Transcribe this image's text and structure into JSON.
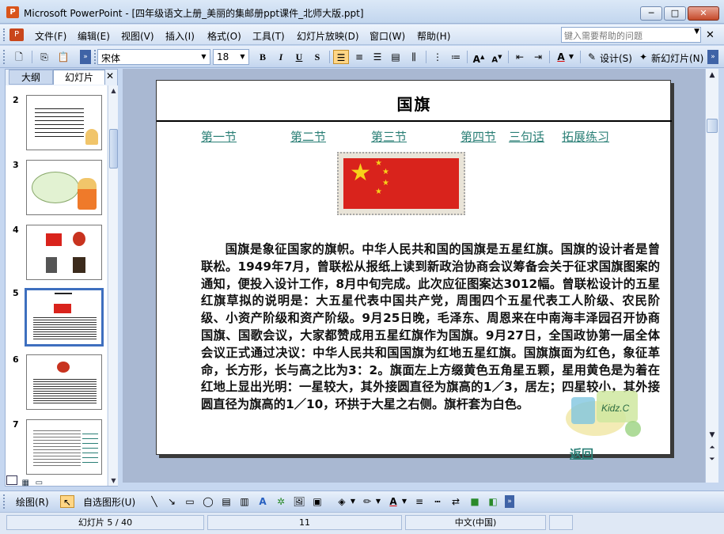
{
  "window": {
    "title": "Microsoft PowerPoint - [四年级语文上册_美丽的集邮册ppt课件_北师大版.ppt]",
    "minimize": "─",
    "maximize": "□",
    "close": "✕"
  },
  "menu": {
    "items": [
      "文件(F)",
      "编辑(E)",
      "视图(V)",
      "插入(I)",
      "格式(O)",
      "工具(T)",
      "幻灯片放映(D)",
      "窗口(W)",
      "帮助(H)"
    ],
    "help_placeholder": "键入需要帮助的问题",
    "mdi_close": "✕"
  },
  "toolbar": {
    "font_name": "宋体",
    "font_size": "18",
    "bold": "B",
    "italic": "I",
    "underline": "U",
    "shadow": "S",
    "design_label": "设计(S)",
    "new_slide_label": "新幻灯片(N)"
  },
  "left_pane": {
    "tab_outline": "大纲",
    "tab_slides": "幻灯片",
    "close": "✕",
    "slide_numbers": [
      "2",
      "3",
      "4",
      "5",
      "6",
      "7"
    ],
    "selected_slide": "5"
  },
  "slide": {
    "title": "国旗",
    "nav_links": [
      "第一节",
      "第二节",
      "第三节",
      "第四节",
      "三句话",
      "拓展练习"
    ],
    "body": "国旗是象征国家的旗帜。中华人民共和国的国旗是五星红旗。国旗的设计者是曾联松。1949年7月，曾联松从报纸上读到新政治协商会议筹备会关于征求国旗图案的通知，便投入设计工作，8月中旬完成。此次应征图案达3012幅。曾联松设计的五星红旗草拟的说明是：大五星代表中国共产党，周围四个五星代表工人阶级、农民阶级、小资产阶级和资产阶级。9月25日晚，毛泽东、周恩来在中南海丰泽园召开协商国旗、国歌会议，大家都赞成用五星红旗作为国旗。9月27日，全国政协第一届全体会议正式通过决议：中华人民共和国国旗为红地五星红旗。国旗旗面为红色，象征革命，长方形，长与高之比为3：2。旗面左上方缀黄色五角星五颗，星用黄色是为着在红地上显出光明：一星较大，其外接圆直径为旗高的1／3，居左；四星较小，其外接圆直径为旗高的1／10，环拱于大星之右侧。旗杆套为白色。",
    "return_link": "返回",
    "kidz_label": "Kidz.C"
  },
  "drawbar": {
    "draw_label": "绘图(R)",
    "autoshape_label": "自选图形(U)"
  },
  "status": {
    "slide_position": "幻灯片 5 / 40",
    "design_name": "11",
    "language": "中文(中国)"
  },
  "colors": {
    "link": "#2a7f76",
    "flag_red": "#d9231c",
    "star_yellow": "#f7d21a",
    "selection": "#3e6fbf"
  }
}
